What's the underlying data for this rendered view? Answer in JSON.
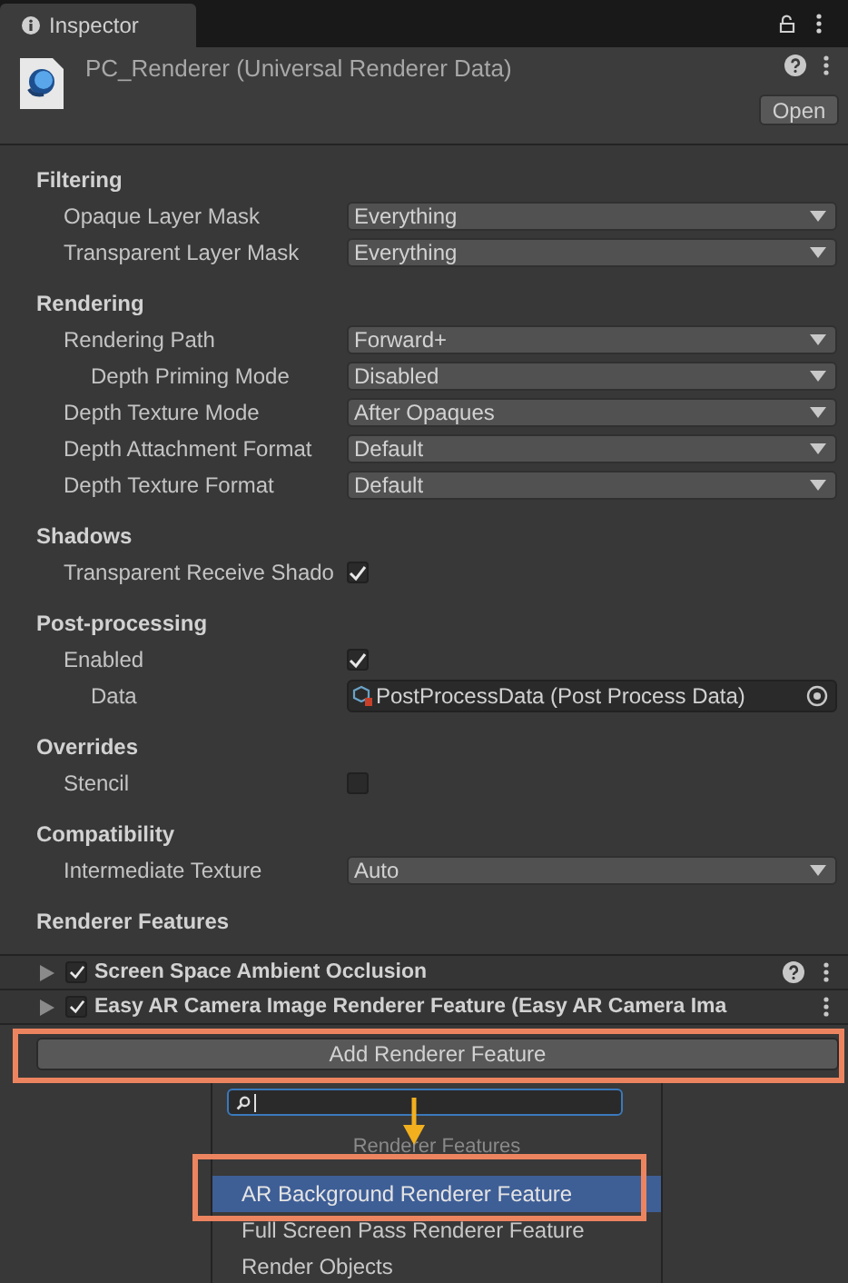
{
  "tab": {
    "label": "Inspector"
  },
  "asset": {
    "title": "PC_Renderer (Universal Renderer Data)",
    "open_button": "Open"
  },
  "sections": [
    {
      "title": "Filtering",
      "rows": [
        {
          "label": "Opaque Layer Mask",
          "kind": "dropdown",
          "value": "Everything"
        },
        {
          "label": "Transparent Layer Mask",
          "kind": "dropdown",
          "value": "Everything"
        }
      ]
    },
    {
      "title": "Rendering",
      "rows": [
        {
          "label": "Rendering Path",
          "kind": "dropdown",
          "value": "Forward+",
          "children": [
            {
              "label": "Depth Priming Mode",
              "kind": "dropdown",
              "value": "Disabled"
            }
          ]
        },
        {
          "label": "Depth Texture Mode",
          "kind": "dropdown",
          "value": "After Opaques"
        },
        {
          "label": "Depth Attachment Format",
          "kind": "dropdown",
          "value": "Default"
        },
        {
          "label": "Depth Texture Format",
          "kind": "dropdown",
          "value": "Default"
        }
      ]
    },
    {
      "title": "Shadows",
      "rows": [
        {
          "label": "Transparent Receive Shado",
          "kind": "checkbox",
          "checked": true
        }
      ]
    },
    {
      "title": "Post-processing",
      "rows": [
        {
          "label": "Enabled",
          "kind": "checkbox",
          "checked": true,
          "children": [
            {
              "label": "Data",
              "kind": "object",
              "value": "PostProcessData (Post Process Data)"
            }
          ]
        }
      ]
    },
    {
      "title": "Overrides",
      "rows": [
        {
          "label": "Stencil",
          "kind": "checkbox",
          "checked": false
        }
      ]
    },
    {
      "title": "Compatibility",
      "rows": [
        {
          "label": "Intermediate Texture",
          "kind": "dropdown",
          "value": "Auto"
        }
      ]
    }
  ],
  "features_title": "Renderer Features",
  "renderer_features": [
    {
      "name": "Screen Space Ambient Occlusion",
      "enabled": true,
      "expanded": false,
      "help": true
    },
    {
      "name": "Easy AR Camera Image Renderer Feature (Easy AR Camera Ima",
      "enabled": true,
      "expanded": false,
      "help": false
    }
  ],
  "add_button": "Add Renderer Feature",
  "popup": {
    "header": "Renderer Features",
    "items": [
      {
        "label": "AR Background Renderer Feature",
        "selected": true
      },
      {
        "label": "Full Screen Pass Renderer Feature",
        "selected": false
      },
      {
        "label": "Render Objects",
        "selected": false
      }
    ]
  }
}
